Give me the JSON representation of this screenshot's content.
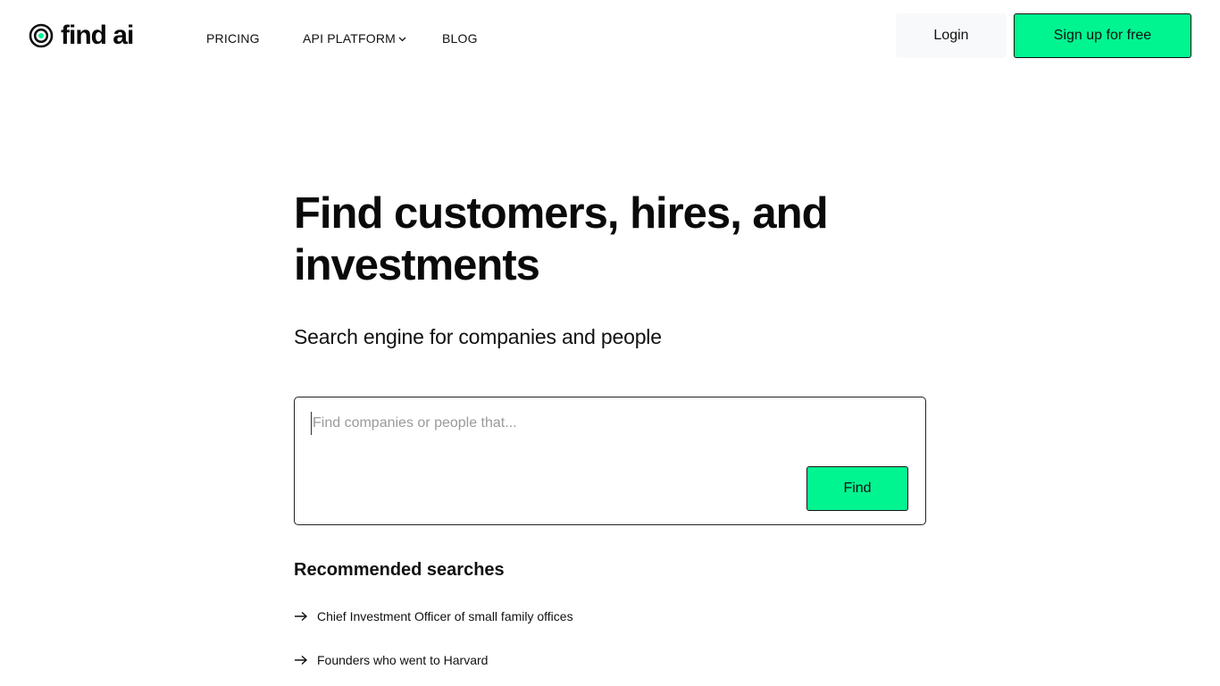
{
  "brand": {
    "logo_text": "find ai",
    "logo_icon": "target-icon",
    "accent_color": "#00f591"
  },
  "nav": {
    "links": [
      {
        "label": "PRICING"
      },
      {
        "label": "API PLATFORM",
        "icon": "chevron-down-icon"
      },
      {
        "label": "BLOG"
      }
    ],
    "login_label": "Login",
    "signup_label": "Sign up for free"
  },
  "hero": {
    "title": "Find customers, hires, and investments",
    "subtitle": "Search engine for companies and people"
  },
  "search": {
    "placeholder": "Find companies or people that...",
    "value": "",
    "button_label": "Find"
  },
  "recommended": {
    "heading": "Recommended searches",
    "items": [
      {
        "label": "Chief Investment Officer of small family offices",
        "icon": "arrow-right-icon"
      },
      {
        "label": "Founders who went to Harvard",
        "icon": "arrow-right-icon"
      }
    ]
  }
}
